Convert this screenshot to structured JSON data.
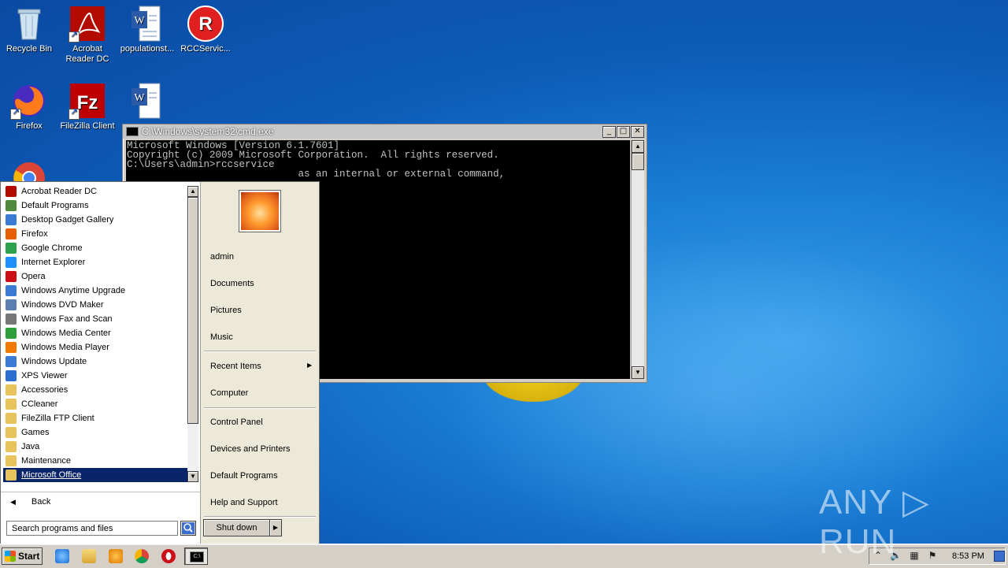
{
  "desktop": {
    "icons": [
      {
        "label": "Recycle Bin"
      },
      {
        "label": "Acrobat Reader DC"
      },
      {
        "label": "populationst..."
      },
      {
        "label": "RCCServic..."
      },
      {
        "label": "Firefox"
      },
      {
        "label": "FileZilla Client"
      },
      {
        "label": ""
      },
      {
        "label": ""
      }
    ]
  },
  "cmd": {
    "title": "C:\\Windows\\system32\\cmd.exe",
    "lines": [
      "Microsoft Windows [Version 6.1.7601]",
      "Copyright (c) 2009 Microsoft Corporation.  All rights reserved.",
      "",
      "C:\\Users\\admin>rccservice",
      "                             as an internal or external command,"
    ],
    "minimize": "_",
    "maximize": "□",
    "close": "✕"
  },
  "start_menu": {
    "programs": [
      {
        "label": "Acrobat Reader DC",
        "color": "#b30b00"
      },
      {
        "label": "Default Programs",
        "color": "#4f8a3c"
      },
      {
        "label": "Desktop Gadget Gallery",
        "color": "#3a7bd5"
      },
      {
        "label": "Firefox",
        "color": "#e66000"
      },
      {
        "label": "Google Chrome",
        "color": "#2da14b"
      },
      {
        "label": "Internet Explorer",
        "color": "#1e90ff"
      },
      {
        "label": "Opera",
        "color": "#cc0f16"
      },
      {
        "label": "Windows Anytime Upgrade",
        "color": "#3a7bd5"
      },
      {
        "label": "Windows DVD Maker",
        "color": "#5a7fb0"
      },
      {
        "label": "Windows Fax and Scan",
        "color": "#777777"
      },
      {
        "label": "Windows Media Center",
        "color": "#2e9e3a"
      },
      {
        "label": "Windows Media Player",
        "color": "#f07a00"
      },
      {
        "label": "Windows Update",
        "color": "#3a7bd5"
      },
      {
        "label": "XPS Viewer",
        "color": "#2a6fd0"
      },
      {
        "label": "Accessories",
        "color": "#e8c25a"
      },
      {
        "label": "CCleaner",
        "color": "#e8c25a"
      },
      {
        "label": "FileZilla FTP Client",
        "color": "#e8c25a"
      },
      {
        "label": "Games",
        "color": "#e8c25a"
      },
      {
        "label": "Java",
        "color": "#e8c25a"
      },
      {
        "label": "Maintenance",
        "color": "#e8c25a"
      },
      {
        "label": "Microsoft Office",
        "color": "#e8c25a"
      }
    ],
    "back_label": "Back",
    "search_placeholder": "Search programs and files",
    "right": {
      "user": "admin",
      "documents": "Documents",
      "pictures": "Pictures",
      "music": "Music",
      "recent_items": "Recent Items",
      "computer": "Computer",
      "control_panel": "Control Panel",
      "devices_printers": "Devices and Printers",
      "default_programs": "Default Programs",
      "help_support": "Help and Support"
    },
    "shutdown_label": "Shut down"
  },
  "taskbar": {
    "start_label": "Start",
    "clock": "8:53 PM"
  },
  "watermark": "ANY ▷ RUN"
}
